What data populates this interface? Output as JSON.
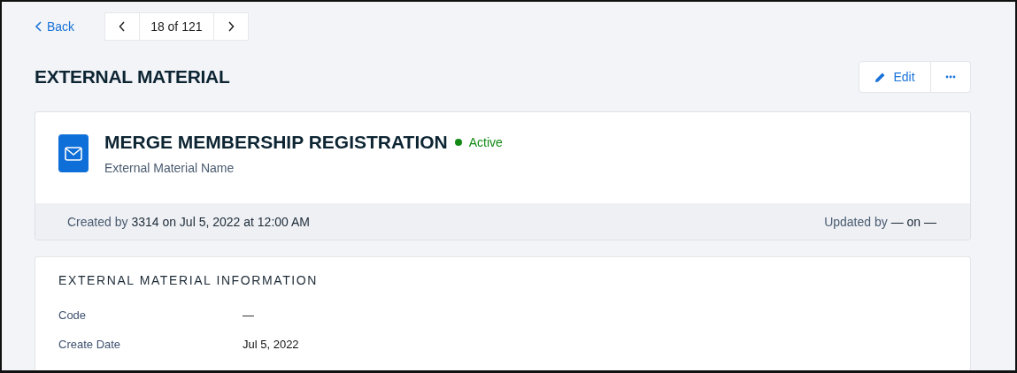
{
  "nav": {
    "back": "Back",
    "pager": "18 of 121"
  },
  "page_title": "EXTERNAL MATERIAL",
  "actions": {
    "edit": "Edit"
  },
  "record": {
    "title": "MERGE MEMBERSHIP REGISTRATION",
    "status": {
      "label": "Active",
      "color": "#138a13"
    },
    "subtitle": "External Material Name",
    "created": {
      "label": "Created by",
      "value": "3314 on Jul 5, 2022 at 12:00 AM"
    },
    "updated": {
      "label": "Updated by",
      "value": "— on —"
    }
  },
  "info": {
    "heading": "EXTERNAL MATERIAL INFORMATION",
    "fields": [
      {
        "label": "Code",
        "value": "—"
      },
      {
        "label": "Create Date",
        "value": "Jul 5, 2022"
      }
    ]
  }
}
